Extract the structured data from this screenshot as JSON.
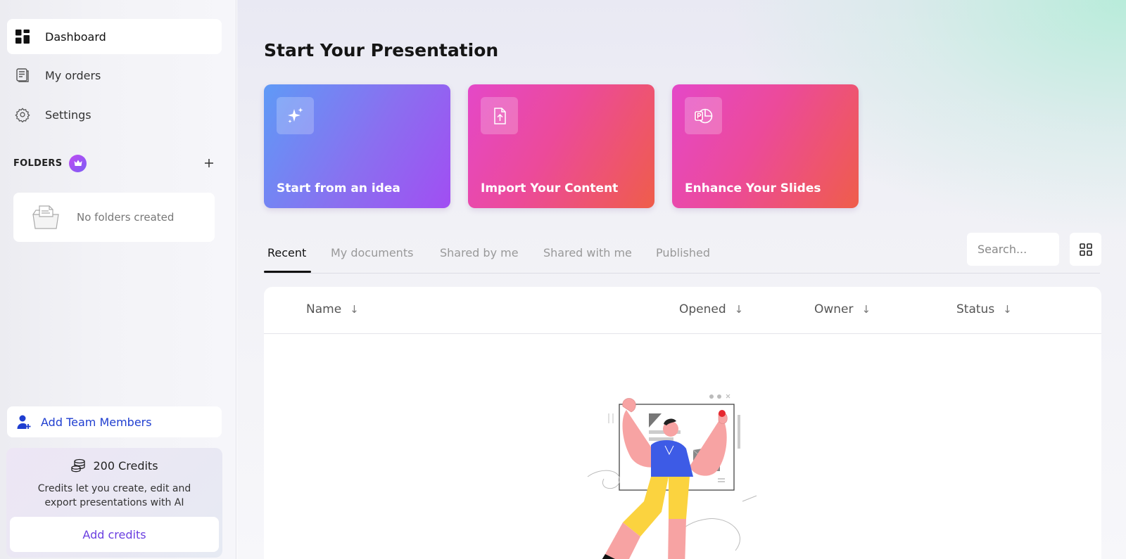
{
  "sidebar": {
    "nav": [
      {
        "label": "Dashboard",
        "icon": "dashboard-icon",
        "active": true
      },
      {
        "label": "My orders",
        "icon": "orders-icon",
        "active": false
      },
      {
        "label": "Settings",
        "icon": "gear-icon",
        "active": false
      }
    ],
    "folders": {
      "label": "FOLDERS",
      "empty_text": "No folders created"
    },
    "team_button": "Add Team Members",
    "credits": {
      "title": "200 Credits",
      "description": "Credits let you create, edit and export presentations with AI",
      "button": "Add credits"
    }
  },
  "main": {
    "title": "Start Your Presentation",
    "cards": [
      {
        "label": "Start from an idea",
        "icon": "sparkles-icon"
      },
      {
        "label": "Import Your Content",
        "icon": "file-upload-icon"
      },
      {
        "label": "Enhance Your Slides",
        "icon": "powerpoint-icon"
      }
    ],
    "tabs": [
      "Recent",
      "My documents",
      "Shared by me",
      "Shared with me",
      "Published"
    ],
    "active_tab": "Recent",
    "search": {
      "placeholder": "Search..."
    },
    "table": {
      "columns": [
        "Name",
        "Opened",
        "Owner",
        "Status"
      ],
      "sort_arrow": "↓"
    }
  },
  "colors": {
    "accent_blue": "#1f3ed0",
    "accent_purple": "#6a3ee0",
    "card_idea_start": "#5f9af6",
    "card_idea_end": "#a14ef2",
    "card_pink_start": "#e448c8",
    "card_pink_end": "#ef5d4a"
  }
}
